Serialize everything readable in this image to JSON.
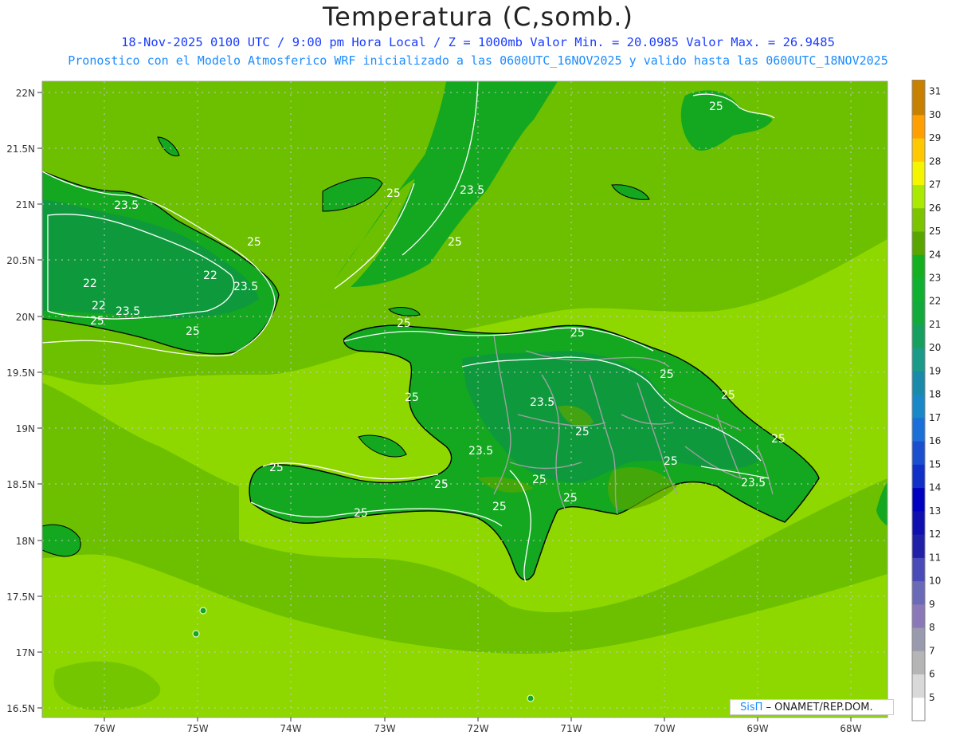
{
  "header": {
    "title": "Temperatura (C,somb.)",
    "line1": "18-Nov-2025  0100 UTC / 9:00 pm Hora Local / Z = 1000mb    Valor Min. = 20.0985  Valor Max. = 26.9485",
    "line2": "Pronostico con el Modelo Atmosferico WRF inicializado a las 0600UTC_16NOV2025 y valido hasta las  0600UTC_18NOV2025"
  },
  "axes": {
    "lat_labels": [
      "22N",
      "21.5N",
      "21N",
      "20.5N",
      "20N",
      "19.5N",
      "19N",
      "18.5N",
      "18N",
      "17.5N",
      "17N",
      "16.5N"
    ],
    "lon_labels": [
      "76W",
      "75W",
      "74W",
      "73W",
      "72W",
      "71W",
      "70W",
      "69W",
      "68W"
    ]
  },
  "contour_labels": [
    {
      "text": "23.5"
    },
    {
      "text": "25"
    },
    {
      "text": "22"
    },
    {
      "text": "22"
    },
    {
      "text": "22"
    },
    {
      "text": "23.5"
    },
    {
      "text": "23.5"
    },
    {
      "text": "25"
    },
    {
      "text": "25"
    },
    {
      "text": "25"
    },
    {
      "text": "25"
    },
    {
      "text": "23.5"
    },
    {
      "text": "25"
    },
    {
      "text": "25"
    },
    {
      "text": "25"
    },
    {
      "text": "25"
    },
    {
      "text": "23.5"
    },
    {
      "text": "25"
    },
    {
      "text": "25"
    },
    {
      "text": "23.5"
    },
    {
      "text": "25"
    },
    {
      "text": "25"
    },
    {
      "text": "25"
    },
    {
      "text": "25"
    },
    {
      "text": "25"
    },
    {
      "text": "25"
    },
    {
      "text": "23.5"
    },
    {
      "text": "25"
    },
    {
      "text": "25"
    },
    {
      "text": "25"
    }
  ],
  "legend": {
    "values": [
      "5",
      "6",
      "7",
      "8",
      "9",
      "10",
      "11",
      "12",
      "13",
      "14",
      "15",
      "16",
      "17",
      "18",
      "19",
      "20",
      "21",
      "22",
      "23",
      "24",
      "25",
      "26",
      "27",
      "28",
      "29",
      "30",
      "31"
    ],
    "colors": [
      "#ffffff",
      "#d9d9d9",
      "#b5b5b5",
      "#9a9aae",
      "#8a78b8",
      "#6a6ab8",
      "#4a4ab8",
      "#2020a8",
      "#1010b0",
      "#0000c0",
      "#1030c8",
      "#1a50d0",
      "#1a70d8",
      "#1888c8",
      "#1a8aaa",
      "#1a9a88",
      "#16a060",
      "#12aa3a",
      "#10b030",
      "#14b020",
      "#5aa600",
      "#7cc400",
      "#aaea00",
      "#f5f500",
      "#ffc800",
      "#ffa000",
      "#c88000"
    ]
  },
  "credit": {
    "brand": "SisΠ",
    "text": " – ONAMET/REP.DOM."
  },
  "colors": {
    "sea_warm": "#8ed800",
    "sea_mid": "#6cc000",
    "land_main": "#13a81f",
    "land_cool": "#0e9a3c",
    "coast": "#000000",
    "contour": "#ffffff",
    "border": "#a0a0a0"
  }
}
